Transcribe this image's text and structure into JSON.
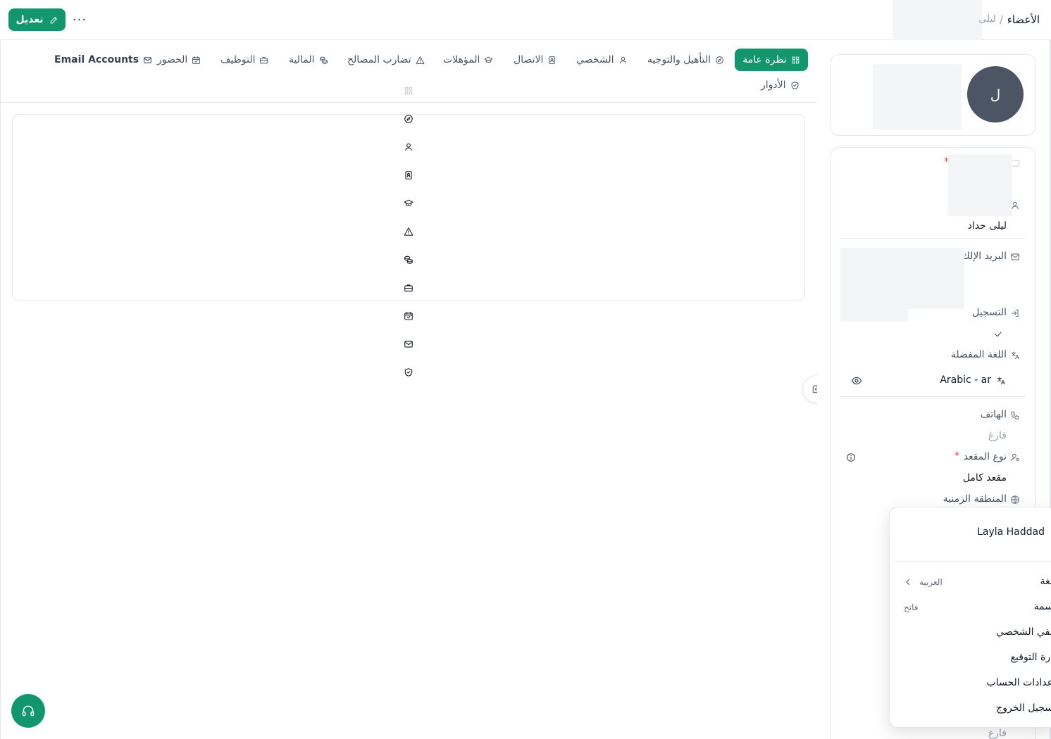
{
  "header": {
    "edit_label": "تعديل",
    "more_label": "···",
    "breadcrumb": {
      "current": "الأعضاء",
      "separator": "/",
      "parent": "ليلى"
    }
  },
  "tabs": [
    {
      "label": "نظرة عامة",
      "icon": "grid-icon",
      "active": true
    },
    {
      "label": "التأهيل والتوجيه",
      "icon": "compass-icon"
    },
    {
      "label": "الشخصي",
      "icon": "user-icon"
    },
    {
      "label": "الاتصال",
      "icon": "contact-book-icon"
    },
    {
      "label": "المؤهلات",
      "icon": "graduation-cap-icon"
    },
    {
      "label": "تضارب المصالح",
      "icon": "warning-icon"
    },
    {
      "label": "المالية",
      "icon": "coins-icon"
    },
    {
      "label": "التوظيف",
      "icon": "briefcase-icon"
    },
    {
      "label": "الحضور",
      "icon": "calendar-check-icon"
    },
    {
      "label": "Email Accounts",
      "icon": "mail-icon"
    },
    {
      "label": "الأدوار",
      "icon": "shield-icon"
    }
  ],
  "profile": {
    "avatar_initial": "ل",
    "name": "ليلى حداد",
    "fields": {
      "email_label": "البريد الإلك",
      "registration_label": "التسجيل",
      "preferred_language_label": "اللغة المفضلة",
      "preferred_language_value": "Arabic - ar",
      "phone_label": "الهاتف",
      "phone_value": "فارغ",
      "seat_type_label": "نوع المقعد",
      "seat_type_value": "مقعد كامل",
      "timezone_label": "المنطقة الزمنية",
      "bottom_empty": "فارغ"
    }
  },
  "user_menu": {
    "user_name": "Layla Haddad",
    "items": [
      {
        "label": "لغة",
        "value": "العربية"
      },
      {
        "label": "سمة",
        "value": "فاتح"
      },
      {
        "label": "لفي الشخصي"
      },
      {
        "label": "ارة التوقيع"
      },
      {
        "label": "عدادات الحساب"
      },
      {
        "label": "سجيل الخروج"
      }
    ]
  },
  "colors": {
    "accent": "#12966b",
    "avatar_bg": "#4b5563",
    "required": "#ef4444"
  }
}
